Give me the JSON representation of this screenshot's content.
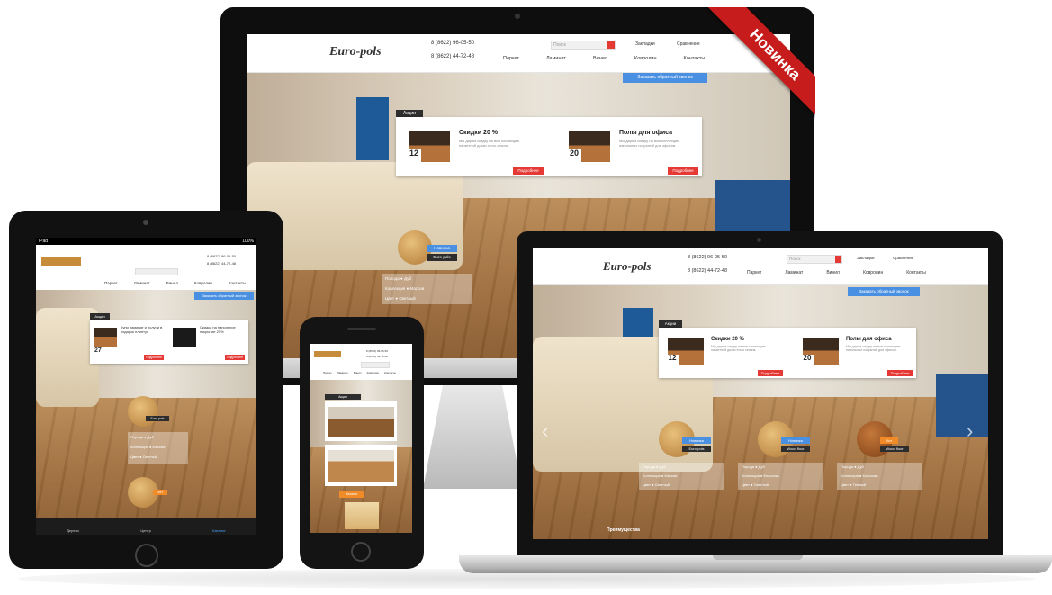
{
  "ribbon": {
    "label": "Новинка"
  },
  "site": {
    "logo": "Euro-pols",
    "phone1": "8 (8622) 96-05-50",
    "phone2": "8 (8622) 44-72-48",
    "search_placeholder": "Поиск",
    "user_links": {
      "favorites": "Закладки",
      "compare": "Сравнение"
    },
    "nav": [
      "Паркет",
      "Ламинат",
      "Винил",
      "Ковролин",
      "Контакты"
    ],
    "callback_button": "Заказать обратный звонок",
    "promo_label": "Акции",
    "promos": [
      {
        "title": "Скидки 20 %",
        "text": "Мы дарим скидку на всю коллекцию паркетной доски этого сезона.",
        "days": "12",
        "unit": "дней",
        "more": "Подробнее"
      },
      {
        "title": "Полы для офиса",
        "text": "Мы дарим скидку на всю коллекцию напольных покрытий для офисов.",
        "days": "20",
        "unit": "дней",
        "more": "Подробнее"
      }
    ],
    "products": [
      {
        "badge": "Новинка",
        "name": "Euro-pols",
        "specs": [
          "Дуб",
          "Массив",
          "Светлый"
        ]
      },
      {
        "badge": "Новинка",
        "name": "Wood floor",
        "specs": [
          "Дуб",
          "Классика",
          "Светлый"
        ]
      },
      {
        "badge": "Хит",
        "name": "Wood floor",
        "specs": [
          "Дуб",
          "Классика",
          "Темный"
        ]
      }
    ],
    "spec_labels": [
      "Порода",
      "Коллекция",
      "Цвет"
    ],
    "footer_label": "Преимущества"
  },
  "tablet": {
    "status_left": "iPad",
    "status_right": "100%",
    "promos": [
      {
        "title": "Купи ламинат и получи в подарок плинтус",
        "days": "27"
      },
      {
        "title": "Скидка на напольное покрытие 20%",
        "days": ""
      }
    ],
    "tabs": [
      "Дерево",
      "Центр",
      "Каталог"
    ]
  },
  "phone": {
    "promo_label": "Акции",
    "button": "Каталог"
  },
  "colors": {
    "accent": "#4a90e2",
    "red": "#e53935",
    "ribbon": "#c61c1c",
    "floor": "#a1703f"
  }
}
